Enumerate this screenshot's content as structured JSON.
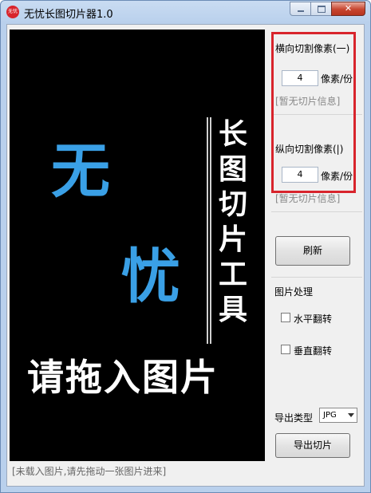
{
  "window": {
    "title": "无忧长图切片器1.0",
    "app_icon_text": "无忧"
  },
  "preview": {
    "logo_char1": "无",
    "logo_char2": "忧",
    "vertical_text": "长图切片工具",
    "prompt_text": "请拖入图片"
  },
  "status_text": "[未载入图片,请先拖动一张图片进来]",
  "horizontal": {
    "label": "横向切割像素(一)",
    "value": "4",
    "unit": "像素/份",
    "info": "[暂无切片信息]"
  },
  "vertical": {
    "label": "纵向切割像素(|)",
    "value": "4",
    "unit": "像素/份",
    "info": "[暂无切片信息]"
  },
  "refresh_button": "刷新",
  "image_processing": {
    "heading": "图片处理",
    "flip_horizontal": "水平翻转",
    "flip_vertical": "垂直翻转"
  },
  "export": {
    "type_label": "导出类型",
    "type_value": "JPG",
    "button": "导出切片"
  },
  "colors": {
    "highlight": "#d8242c",
    "logo_blue": "#3aa0e6"
  },
  "icons": [
    "minimize-icon",
    "maximize-icon",
    "close-icon",
    "dropdown-arrow-icon"
  ]
}
